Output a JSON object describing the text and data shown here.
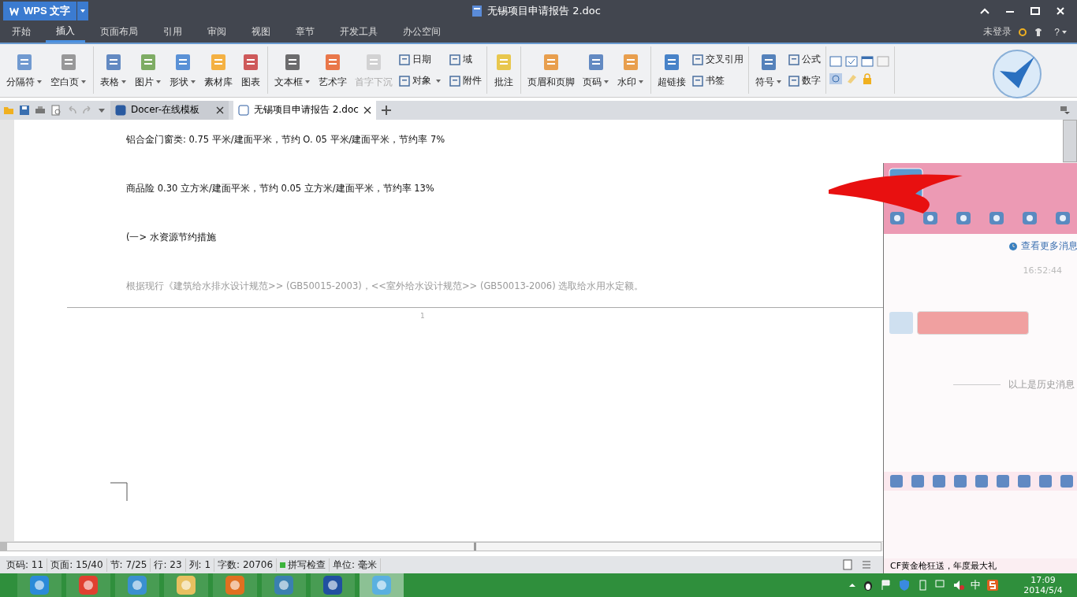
{
  "app_menu": {
    "label": "WPS 文字"
  },
  "window": {
    "title": "无锡项目申请报告 2.doc"
  },
  "menu_tabs": [
    {
      "label": "开始",
      "selected": false
    },
    {
      "label": "插入",
      "selected": true
    },
    {
      "label": "页面布局",
      "selected": false
    },
    {
      "label": "引用",
      "selected": false
    },
    {
      "label": "审阅",
      "selected": false
    },
    {
      "label": "视图",
      "selected": false
    },
    {
      "label": "章节",
      "selected": false
    },
    {
      "label": "开发工具",
      "selected": false
    },
    {
      "label": "办公空间",
      "selected": false
    }
  ],
  "account": {
    "label": "未登录",
    "help": "?"
  },
  "ribbon": [
    {
      "large": [
        {
          "label": "分隔符",
          "dropdown": true,
          "disabled": false
        },
        {
          "label": "空白页",
          "dropdown": true,
          "disabled": false
        }
      ]
    },
    {
      "large": [
        {
          "label": "表格",
          "dropdown": true,
          "disabled": false
        },
        {
          "label": "图片",
          "dropdown": true,
          "disabled": false
        },
        {
          "label": "形状",
          "dropdown": true,
          "disabled": false
        },
        {
          "label": "素材库",
          "dropdown": false,
          "disabled": false
        },
        {
          "label": "图表",
          "dropdown": false,
          "disabled": false
        }
      ]
    },
    {
      "large": [
        {
          "label": "文本框",
          "dropdown": true,
          "disabled": false
        },
        {
          "label": "艺术字",
          "dropdown": false,
          "disabled": false
        },
        {
          "label": "首字下沉",
          "dropdown": false,
          "disabled": true
        }
      ],
      "small": [
        {
          "label": "日期",
          "dropdown": false
        },
        {
          "label": "对象",
          "dropdown": true
        },
        {
          "label": "域",
          "dropdown": false
        },
        {
          "label": "附件",
          "dropdown": false
        }
      ]
    },
    {
      "large": [
        {
          "label": "批注",
          "dropdown": false,
          "disabled": false
        }
      ]
    },
    {
      "large": [
        {
          "label": "页眉和页脚",
          "dropdown": false,
          "disabled": false
        },
        {
          "label": "页码",
          "dropdown": true,
          "disabled": false
        },
        {
          "label": "水印",
          "dropdown": true,
          "disabled": false
        }
      ]
    },
    {
      "large": [
        {
          "label": "超链接",
          "dropdown": false,
          "disabled": false
        }
      ],
      "small": [
        {
          "label": "交叉引用",
          "dropdown": false
        },
        {
          "label": "书签",
          "dropdown": false
        }
      ]
    },
    {
      "large": [
        {
          "label": "符号",
          "dropdown": true,
          "disabled": false
        }
      ],
      "small": [
        {
          "label": "公式",
          "dropdown": false
        },
        {
          "label": "数字",
          "dropdown": false
        }
      ]
    }
  ],
  "doc_tabs": [
    {
      "label": "Docer-在线模板",
      "selected": false
    },
    {
      "label": "无锡项目申请报告 2.doc",
      "selected": true
    }
  ],
  "document": {
    "paragraphs": [
      {
        "kind": "body",
        "text": "铝合金门窗类: 0.75 平米/建面平米，节约 O. 05 平米/建面平米，节约率 7%"
      },
      {
        "kind": "body",
        "text": "商品险  0.30 立方米/建面平米，节约 0.05 立方米/建面平米，节约率 13%"
      },
      {
        "kind": "body",
        "text": "(一> 水资源节约措施"
      },
      {
        "kind": "faded",
        "text": "根据现行《建筑给水排水设计规范>> (GB50015-2003)，<<室外给水设计规范>> (GB50013-2006) 选取给水用水定额。"
      }
    ],
    "page_number": "1"
  },
  "status_bar": {
    "items": [
      "页码: 11",
      "页面: 15/40",
      "节: 7/25",
      "行: 23",
      "列: 1",
      "字数: 20706"
    ],
    "spell_check": {
      "label": "拼写检查",
      "on": true
    },
    "unit": "单位: 毫米"
  },
  "chat": {
    "more_messages": "查看更多消息",
    "time": "16:52:44",
    "history_note": "以上是历史消息",
    "ad": "CF黄金枪狂送，年度最大礼"
  },
  "taskbar": {
    "apps": [
      {
        "selected": false
      },
      {
        "selected": false
      },
      {
        "selected": false
      },
      {
        "selected": false
      },
      {
        "selected": false
      },
      {
        "selected": false
      },
      {
        "selected": false
      },
      {
        "selected": true
      }
    ],
    "ime": "中",
    "time": "17:09",
    "date": "2014/5/4"
  }
}
